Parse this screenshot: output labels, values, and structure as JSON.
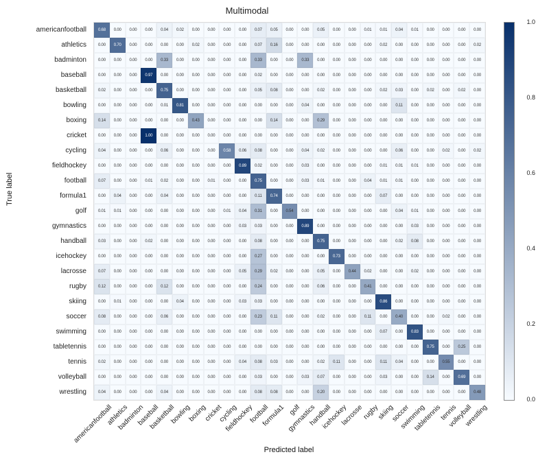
{
  "chart_data": {
    "type": "heatmap",
    "title": "Multimodal",
    "xlabel": "Predicted label",
    "ylabel": "True label",
    "colormap": "Blues",
    "vmin": 0.0,
    "vmax": 1.0,
    "colorbar_ticks": [
      0.0,
      0.2,
      0.4,
      0.6,
      0.8,
      1.0
    ],
    "categories": [
      "americanfootball",
      "athletics",
      "badminton",
      "baseball",
      "basketball",
      "bowling",
      "boxing",
      "cricket",
      "cycling",
      "fieldhockey",
      "football",
      "formula1",
      "golf",
      "gymnastics",
      "handball",
      "icehockey",
      "lacrosse",
      "rugby",
      "skiing",
      "soccer",
      "swimming",
      "tabletennis",
      "tennis",
      "volleyball",
      "wrestling"
    ],
    "matrix": [
      [
        0.68,
        0.0,
        0.0,
        0.0,
        0.04,
        0.02,
        0.0,
        0.0,
        0.0,
        0.0,
        0.07,
        0.05,
        0.0,
        0.0,
        0.05,
        0.0,
        0.0,
        0.01,
        0.01,
        0.04,
        0.01,
        0.0,
        0.0,
        0.0,
        0.0
      ],
      [
        0.0,
        0.7,
        0.0,
        0.0,
        0.0,
        0.0,
        0.02,
        0.0,
        0.0,
        0.0,
        0.07,
        0.16,
        0.0,
        0.0,
        0.0,
        0.0,
        0.0,
        0.0,
        0.02,
        0.0,
        0.0,
        0.0,
        0.0,
        0.0,
        0.02
      ],
      [
        0.0,
        0.0,
        0.0,
        0.0,
        0.33,
        0.0,
        0.0,
        0.0,
        0.0,
        0.0,
        0.33,
        0.0,
        0.0,
        0.33,
        0.0,
        0.0,
        0.0,
        0.0,
        0.0,
        0.0,
        0.0,
        0.0,
        0.0,
        0.0,
        0.0
      ],
      [
        0.0,
        0.0,
        0.0,
        0.97,
        0.0,
        0.0,
        0.0,
        0.0,
        0.0,
        0.0,
        0.02,
        0.0,
        0.0,
        0.0,
        0.0,
        0.0,
        0.0,
        0.0,
        0.0,
        0.0,
        0.0,
        0.0,
        0.0,
        0.0,
        0.0
      ],
      [
        0.02,
        0.0,
        0.0,
        0.0,
        0.75,
        0.0,
        0.0,
        0.0,
        0.0,
        0.0,
        0.05,
        0.08,
        0.0,
        0.0,
        0.02,
        0.0,
        0.0,
        0.0,
        0.02,
        0.03,
        0.0,
        0.02,
        0.0,
        0.02,
        0.0
      ],
      [
        0.0,
        0.0,
        0.0,
        0.0,
        0.01,
        0.81,
        0.0,
        0.0,
        0.0,
        0.0,
        0.0,
        0.0,
        0.0,
        0.04,
        0.0,
        0.0,
        0.0,
        0.0,
        0.0,
        0.11,
        0.0,
        0.0,
        0.0,
        0.0,
        0.0
      ],
      [
        0.14,
        0.0,
        0.0,
        0.0,
        0.0,
        0.0,
        0.43,
        0.0,
        0.0,
        0.0,
        0.0,
        0.14,
        0.0,
        0.0,
        0.29,
        0.0,
        0.0,
        0.0,
        0.0,
        0.0,
        0.0,
        0.0,
        0.0,
        0.0,
        0.0
      ],
      [
        0.0,
        0.0,
        0.0,
        1.0,
        0.0,
        0.0,
        0.0,
        0.0,
        0.0,
        0.0,
        0.0,
        0.0,
        0.0,
        0.0,
        0.0,
        0.0,
        0.0,
        0.0,
        0.0,
        0.0,
        0.0,
        0.0,
        0.0,
        0.0,
        0.0
      ],
      [
        0.04,
        0.0,
        0.0,
        0.0,
        0.06,
        0.0,
        0.0,
        0.0,
        0.58,
        0.06,
        0.08,
        0.0,
        0.0,
        0.04,
        0.02,
        0.0,
        0.0,
        0.0,
        0.0,
        0.06,
        0.0,
        0.0,
        0.02,
        0.0,
        0.02
      ],
      [
        0.0,
        0.0,
        0.0,
        0.0,
        0.0,
        0.0,
        0.0,
        0.0,
        0.0,
        0.89,
        0.02,
        0.0,
        0.0,
        0.03,
        0.0,
        0.0,
        0.0,
        0.0,
        0.01,
        0.01,
        0.01,
        0.0,
        0.0,
        0.0,
        0.0
      ],
      [
        0.07,
        0.0,
        0.0,
        0.01,
        0.02,
        0.0,
        0.0,
        0.01,
        0.0,
        0.0,
        0.75,
        0.0,
        0.0,
        0.03,
        0.01,
        0.0,
        0.0,
        0.04,
        0.01,
        0.01,
        0.0,
        0.0,
        0.0,
        0.0,
        0.0
      ],
      [
        0.0,
        0.04,
        0.0,
        0.0,
        0.04,
        0.0,
        0.0,
        0.0,
        0.0,
        0.0,
        0.11,
        0.74,
        0.0,
        0.0,
        0.0,
        0.0,
        0.0,
        0.0,
        0.07,
        0.0,
        0.0,
        0.0,
        0.0,
        0.0,
        0.0
      ],
      [
        0.01,
        0.01,
        0.0,
        0.0,
        0.0,
        0.0,
        0.0,
        0.0,
        0.01,
        0.04,
        0.31,
        0.0,
        0.54,
        0.0,
        0.0,
        0.0,
        0.0,
        0.0,
        0.0,
        0.04,
        0.01,
        0.0,
        0.0,
        0.0,
        0.0
      ],
      [
        0.0,
        0.0,
        0.0,
        0.0,
        0.0,
        0.0,
        0.0,
        0.0,
        0.0,
        0.03,
        0.03,
        0.0,
        0.0,
        0.89,
        0.0,
        0.0,
        0.0,
        0.0,
        0.0,
        0.0,
        0.03,
        0.0,
        0.0,
        0.0,
        0.0
      ],
      [
        0.03,
        0.0,
        0.0,
        0.02,
        0.0,
        0.0,
        0.0,
        0.0,
        0.0,
        0.0,
        0.08,
        0.0,
        0.0,
        0.0,
        0.75,
        0.0,
        0.0,
        0.0,
        0.0,
        0.02,
        0.08,
        0.0,
        0.0,
        0.0,
        0.0
      ],
      [
        0.0,
        0.0,
        0.0,
        0.0,
        0.0,
        0.0,
        0.0,
        0.0,
        0.0,
        0.0,
        0.27,
        0.0,
        0.0,
        0.0,
        0.0,
        0.73,
        0.0,
        0.0,
        0.0,
        0.0,
        0.0,
        0.0,
        0.0,
        0.0,
        0.0
      ],
      [
        0.07,
        0.0,
        0.0,
        0.0,
        0.0,
        0.0,
        0.0,
        0.0,
        0.0,
        0.05,
        0.29,
        0.02,
        0.0,
        0.0,
        0.05,
        0.0,
        0.44,
        0.02,
        0.0,
        0.0,
        0.02,
        0.0,
        0.0,
        0.0,
        0.0
      ],
      [
        0.12,
        0.0,
        0.0,
        0.0,
        0.12,
        0.0,
        0.0,
        0.0,
        0.0,
        0.0,
        0.24,
        0.0,
        0.0,
        0.0,
        0.06,
        0.0,
        0.0,
        0.41,
        0.0,
        0.0,
        0.0,
        0.0,
        0.0,
        0.0,
        0.0
      ],
      [
        0.0,
        0.01,
        0.0,
        0.0,
        0.0,
        0.04,
        0.0,
        0.0,
        0.0,
        0.03,
        0.03,
        0.0,
        0.0,
        0.0,
        0.0,
        0.0,
        0.0,
        0.0,
        0.86,
        0.0,
        0.0,
        0.0,
        0.0,
        0.0,
        0.0
      ],
      [
        0.08,
        0.0,
        0.0,
        0.0,
        0.06,
        0.0,
        0.0,
        0.0,
        0.0,
        0.0,
        0.23,
        0.11,
        0.0,
        0.0,
        0.02,
        0.0,
        0.0,
        0.11,
        0.0,
        0.4,
        0.0,
        0.0,
        0.02,
        0.0,
        0.0
      ],
      [
        0.0,
        0.0,
        0.0,
        0.0,
        0.0,
        0.0,
        0.0,
        0.0,
        0.0,
        0.0,
        0.0,
        0.0,
        0.0,
        0.0,
        0.0,
        0.0,
        0.0,
        0.0,
        0.07,
        0.0,
        0.83,
        0.0,
        0.0,
        0.0,
        0.0
      ],
      [
        0.0,
        0.0,
        0.0,
        0.0,
        0.0,
        0.0,
        0.0,
        0.0,
        0.0,
        0.0,
        0.0,
        0.0,
        0.0,
        0.0,
        0.0,
        0.0,
        0.0,
        0.0,
        0.0,
        0.0,
        0.0,
        0.75,
        0.0,
        0.25,
        0.0
      ],
      [
        0.02,
        0.0,
        0.0,
        0.0,
        0.0,
        0.0,
        0.0,
        0.0,
        0.0,
        0.04,
        0.08,
        0.03,
        0.0,
        0.0,
        0.02,
        0.11,
        0.0,
        0.0,
        0.11,
        0.04,
        0.0,
        0.0,
        0.55,
        0.0,
        0.0
      ],
      [
        0.0,
        0.0,
        0.0,
        0.0,
        0.0,
        0.0,
        0.0,
        0.0,
        0.0,
        0.0,
        0.03,
        0.0,
        0.0,
        0.03,
        0.07,
        0.0,
        0.0,
        0.0,
        0.03,
        0.0,
        0.0,
        0.14,
        0.0,
        0.69,
        0.0
      ],
      [
        0.04,
        0.0,
        0.0,
        0.0,
        0.04,
        0.0,
        0.0,
        0.0,
        0.0,
        0.0,
        0.08,
        0.08,
        0.0,
        0.0,
        0.2,
        0.0,
        0.0,
        0.0,
        0.0,
        0.0,
        0.0,
        0.0,
        0.0,
        0.0,
        0.48
      ]
    ]
  }
}
